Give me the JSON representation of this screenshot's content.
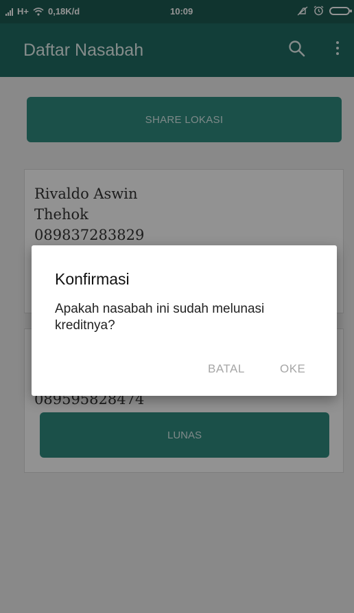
{
  "status_bar": {
    "network": "H+",
    "speed": "0,18K/d",
    "time": "10:09"
  },
  "app_bar": {
    "title": "Daftar Nasabah",
    "search_icon": "search-icon",
    "menu_icon": "more-vert-icon"
  },
  "main": {
    "share_button": "SHARE LOKASI",
    "cards": [
      {
        "name_line1": "Rivaldo Aswin",
        "name_line2": "Thehok",
        "phone": "089837283829"
      },
      {
        "phone": "089595828474",
        "button": "LUNAS"
      }
    ]
  },
  "dialog": {
    "title": "Konfirmasi",
    "message": "Apakah nasabah ini sudah melunasi kreditnya?",
    "cancel": "BATAL",
    "ok": "OKE"
  },
  "colors": {
    "primary_dark": "#1c5a52",
    "primary": "#1f6b62",
    "accent_button": "#2f8a7f"
  }
}
